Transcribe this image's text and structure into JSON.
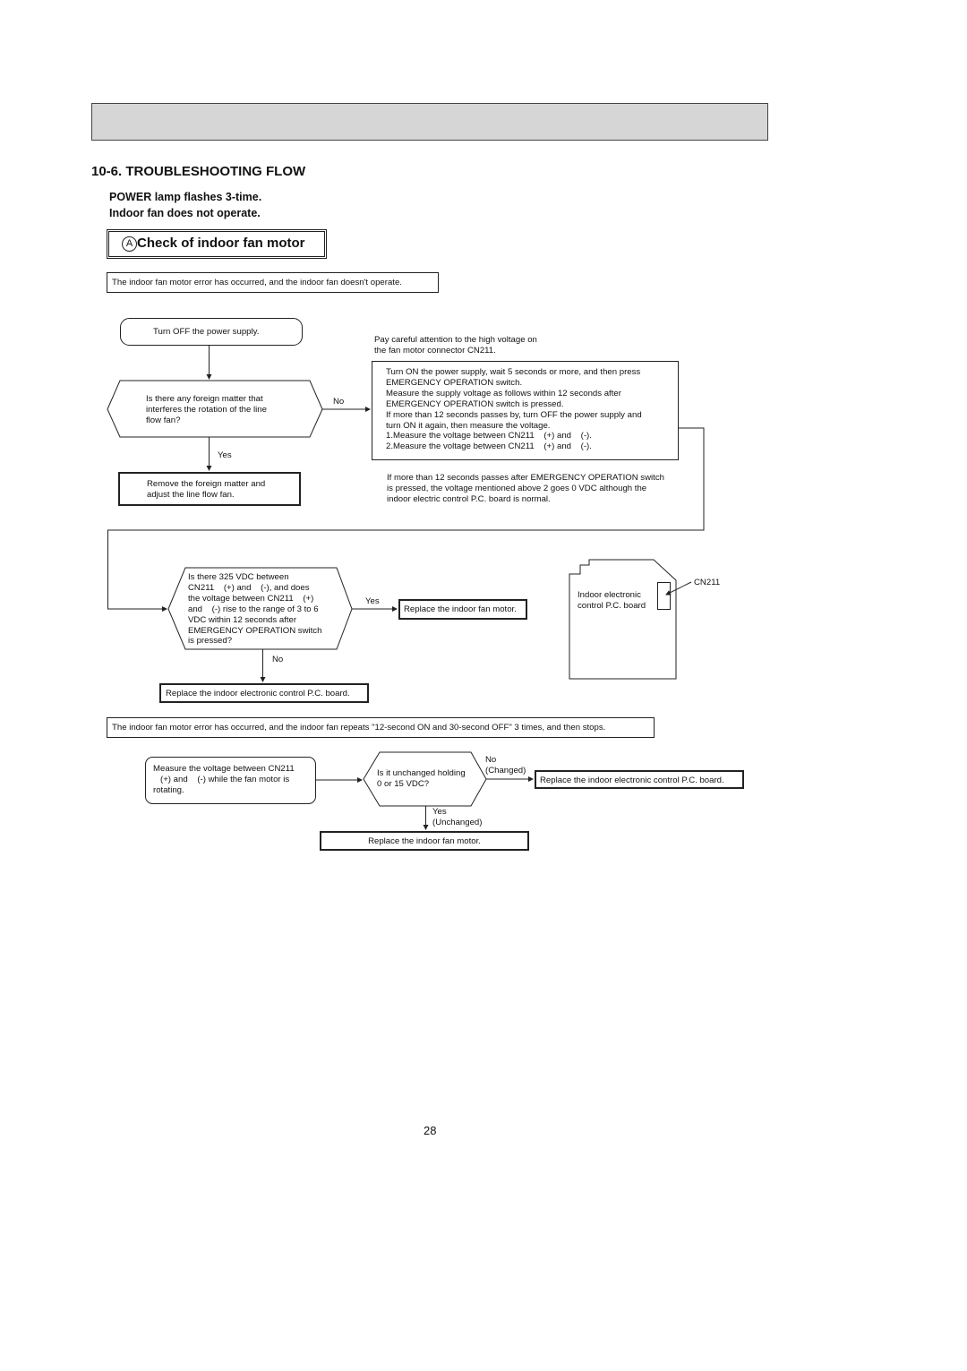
{
  "section_title": "10-6. TROUBLESHOOTING FLOW",
  "symptom": [
    "POWER lamp flashes 3-time.",
    "Indoor fan does not operate."
  ],
  "check_title": "ACheck of indoor fan motor",
  "check_letter": "A",
  "check_text": "Check of indoor fan motor",
  "case1": {
    "header": "The indoor fan motor error has occurred, and the indoor fan doesn't operate.",
    "start": "Turn OFF the power supply.",
    "q1": "Is there any foreign matter that\ninterferes the rotation of the line\nflow fan?",
    "q1_no": "No",
    "q1_yes": "Yes",
    "remove": "Remove the foreign matter and\nadjust the line flow fan.",
    "caution": "Pay careful attention to the high voltage on\nthe fan motor connector CN211.",
    "measure": "Turn ON the power supply, wait 5 seconds or more, and then press\nEMERGENCY OPERATION switch.\nMeasure the supply voltage as follows within 12 seconds after\nEMERGENCY OPERATION switch is pressed.\nIf more than 12 seconds passes by, turn OFF the power supply and\nturn ON it again, then measure the voltage.\n1.Measure the voltage between CN211    (+) and    (-).\n2.Measure the voltage between CN211    (+) and    (-).",
    "note": "If more than 12 seconds passes after EMERGENCY OPERATION switch\nis pressed, the voltage mentioned above 2 goes 0 VDC although the\nindoor electric control P.C. board is normal.",
    "q2": "Is there 325 VDC between\nCN211    (+) and    (-), and does\nthe voltage between CN211    (+)\nand    (-) rise to the range of 3 to 6\nVDC within 12 seconds after\nEMERGENCY OPERATION switch\nis pressed?",
    "q2_yes": "Yes",
    "q2_no": "No",
    "replace_motor": "Replace the indoor fan motor.",
    "replace_board": "Replace the indoor electronic control P.C. board.",
    "board_label": "Indoor electronic\ncontrol P.C. board",
    "connector_label": "CN211"
  },
  "case2": {
    "header": "The indoor fan motor error has occurred, and the indoor fan repeats \"12-second ON and 30-second OFF\" 3 times, and then stops.",
    "measure": "Measure the voltage between CN211\n   (+) and    (-) while the fan motor is\nrotating.",
    "q": "Is it unchanged holding\n0 or 15 VDC?",
    "no": "No",
    "no_sub": "(Changed)",
    "yes": "Yes",
    "yes_sub": "(Unchanged)",
    "replace_board": "Replace the indoor electronic control P.C. board.",
    "replace_motor": "Replace the indoor fan motor."
  },
  "page_number": "28"
}
